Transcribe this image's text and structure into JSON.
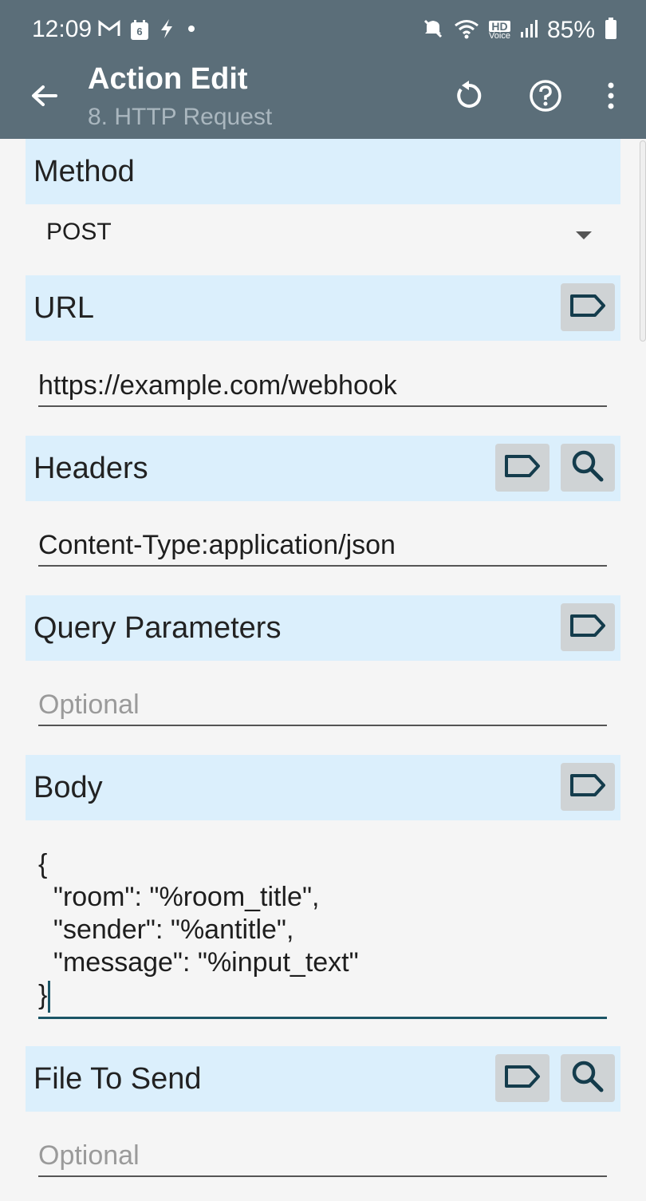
{
  "status_bar": {
    "time": "12:09",
    "left_icons": [
      "gmail-icon",
      "calendar-icon",
      "flash-icon",
      "dot-icon"
    ],
    "calendar_day": "6",
    "hd_label": "HD",
    "voice_label": "Voice",
    "battery": "85%",
    "right_icons": [
      "mute-icon",
      "wifi-icon",
      "hd-voice-icon",
      "signal-icon",
      "battery-icon"
    ]
  },
  "app_bar": {
    "title": "Action Edit",
    "subtitle": "8. HTTP Request",
    "icons": [
      "back-arrow-icon",
      "reset-icon",
      "help-icon",
      "more-vert-icon"
    ],
    "color": "#5b6e79"
  },
  "sections": {
    "method": {
      "label": "Method",
      "value": "POST"
    },
    "url": {
      "label": "URL",
      "value": "https://example.com/webhook"
    },
    "headers": {
      "label": "Headers",
      "value": "Content-Type:application/json"
    },
    "query": {
      "label": "Query Parameters",
      "placeholder": "Optional"
    },
    "body": {
      "label": "Body",
      "lines": [
        "{",
        "  \"room\": \"%room_title\",",
        "  \"sender\": \"%antitle\",",
        "  \"message\": \"%input_text\"",
        "}"
      ]
    },
    "file": {
      "label": "File To Send",
      "placeholder": "Optional"
    }
  },
  "colors": {
    "section_bg": "#dbeffc",
    "button_bg": "#cfd3d5",
    "icon_color": "#143c4c",
    "focus_underline": "#1b5566"
  }
}
